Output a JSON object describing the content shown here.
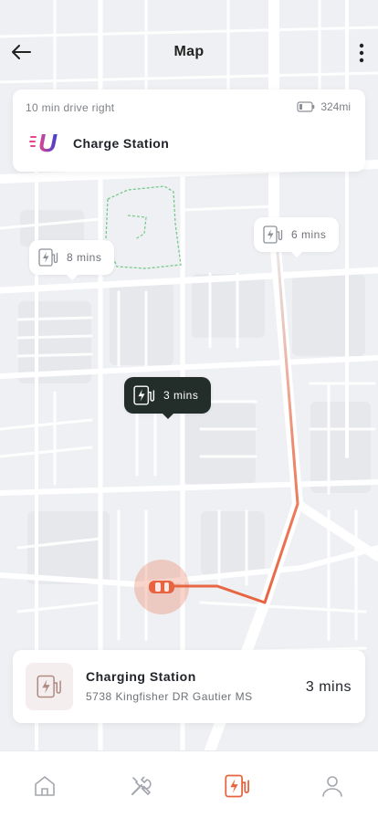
{
  "header": {
    "title": "Map"
  },
  "info_card": {
    "drive_text": "10 min drive right",
    "battery_range": "324mi",
    "station_name": "Charge Station",
    "logo_letter": "U"
  },
  "map_pins": [
    {
      "label": "8 mins",
      "variant": "light"
    },
    {
      "label": "6 mins",
      "variant": "light"
    },
    {
      "label": "3 mins",
      "variant": "dark",
      "selected": true
    }
  ],
  "bottom_card": {
    "title": "Charging Station",
    "address": "5738 Kingfisher DR Gautier MS",
    "time": "3 mins"
  },
  "tab_bar": {
    "items": [
      {
        "icon": "home-icon",
        "active": false
      },
      {
        "icon": "tools-icon",
        "active": false
      },
      {
        "icon": "charging-station-icon",
        "active": true
      },
      {
        "icon": "profile-icon",
        "active": false
      }
    ]
  },
  "colors": {
    "accent": "#e8633f",
    "pin_dark": "#232d29",
    "logo_gradient_start": "#e8458c",
    "logo_gradient_end": "#3a3fd1",
    "park_outline": "#76c98d",
    "map_background": "#eef0f3",
    "road": "#ffffff"
  }
}
